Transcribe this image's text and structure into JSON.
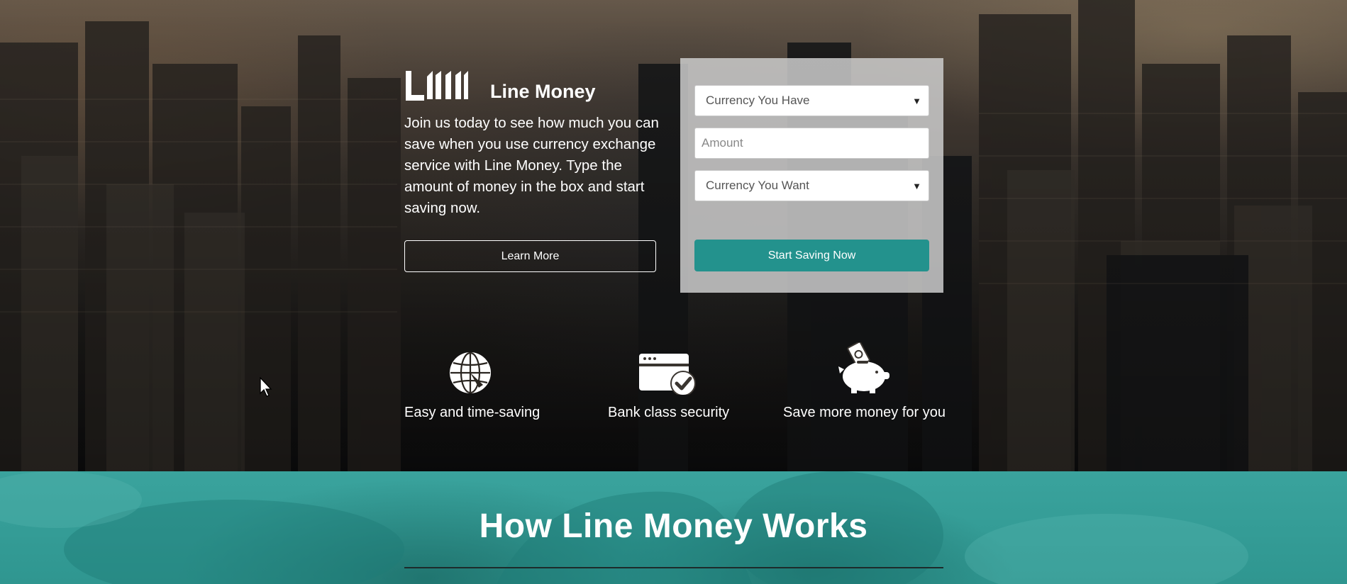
{
  "brand": {
    "logo_letters": "LM",
    "name": "Line Money"
  },
  "intro": {
    "text": "Join us today to see how much you can save when you use currency exchange service with Line Money. Type the amount of money in the box and start saving now."
  },
  "buttons": {
    "learn_more": "Learn More",
    "start_saving": "Start Saving Now"
  },
  "form": {
    "currency_have": {
      "selected": "Currency You Have"
    },
    "amount": {
      "placeholder": "Amount"
    },
    "currency_want": {
      "selected": "Currency You Want"
    }
  },
  "features": [
    {
      "icon": "globe-clock-icon",
      "label": "Easy and time-saving"
    },
    {
      "icon": "card-check-icon",
      "label": "Bank class security"
    },
    {
      "icon": "piggy-bank-icon",
      "label": "Save more money for you"
    }
  ],
  "how": {
    "title": "How Line Money Works"
  },
  "colors": {
    "accent": "#23928d",
    "section_bg": "#3aa39d",
    "panel_bg": "#cdcdcd"
  }
}
